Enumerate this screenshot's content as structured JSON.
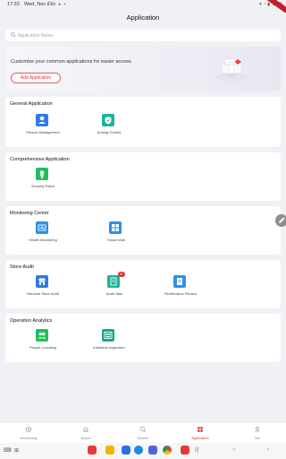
{
  "status_bar": {
    "time": "17:33",
    "date": "Wed, Nov 21",
    "battery": "96%"
  },
  "app": {
    "title": "Application"
  },
  "search": {
    "placeholder": "Application Name"
  },
  "banner": {
    "text": "Customize your common applications for easier access.",
    "button": "Add Application"
  },
  "sections": [
    {
      "title": "General Application",
      "items": [
        {
          "label": "Person Management",
          "icon": "person-icon",
          "color": "#2f7ae5"
        },
        {
          "label": "Arming Control",
          "icon": "shield-check-icon",
          "color": "#1bb49a"
        }
      ]
    },
    {
      "title": "Comprehensive Application",
      "items": [
        {
          "label": "Security Patrol",
          "icon": "patrol-icon",
          "color": "#21c05a"
        }
      ]
    },
    {
      "title": "Monitoring Center",
      "items": [
        {
          "label": "Health Monitoring",
          "icon": "health-icon",
          "color": "#2f90e8"
        },
        {
          "label": "Smart Wall",
          "icon": "wall-grid-icon",
          "color": "#2f90e8"
        }
      ]
    },
    {
      "title": "Store Audit",
      "items": [
        {
          "label": "Random Store Audit",
          "icon": "store-audit-icon",
          "color": "#2f7ae5"
        },
        {
          "label": "Audit Task",
          "icon": "audit-task-icon",
          "color": "#1bb49a",
          "badge": "37"
        },
        {
          "label": "Rectification Review",
          "icon": "review-icon",
          "color": "#2f90e8"
        }
      ]
    },
    {
      "title": "Operation Analytics",
      "items": [
        {
          "label": "People Counting",
          "icon": "people-count-icon",
          "color": "#21c05a"
        },
        {
          "label": "Industrial Inspection",
          "icon": "inspection-icon",
          "color": "#17a889"
        }
      ]
    }
  ],
  "tabs": [
    {
      "label": "Monitoring",
      "icon": "camera-icon"
    },
    {
      "label": "Alarm",
      "icon": "bell-icon"
    },
    {
      "label": "Search",
      "icon": "search-icon"
    },
    {
      "label": "Application",
      "icon": "grid-icon",
      "active": true
    },
    {
      "label": "Me",
      "icon": "user-icon"
    }
  ],
  "colors": {
    "accent": "#e03030",
    "background": "#f0f1f4"
  }
}
